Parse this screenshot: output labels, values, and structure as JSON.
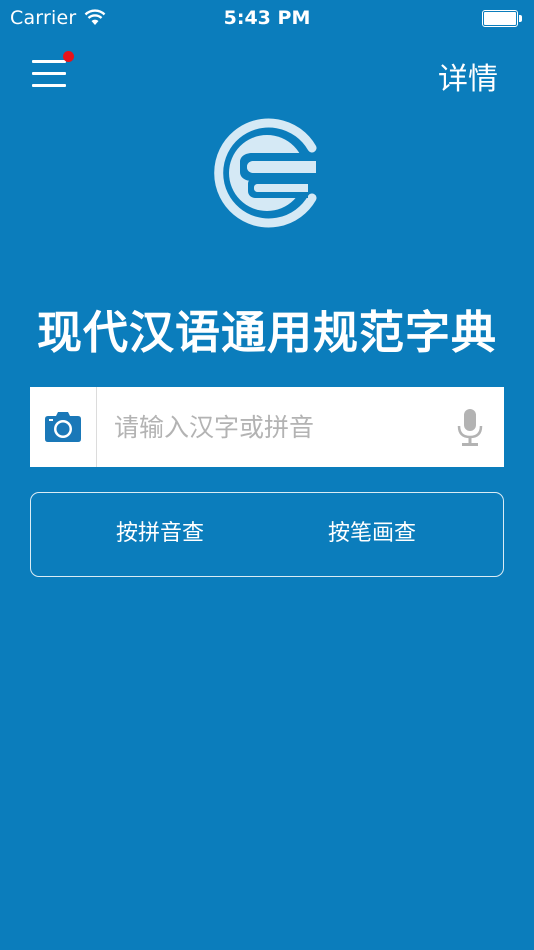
{
  "status_bar": {
    "carrier": "Carrier",
    "time": "5:43 PM",
    "wifi_icon": "wifi-icon",
    "battery_icon": "battery-icon"
  },
  "nav": {
    "menu_icon": "hamburger-menu-icon",
    "notification_dot_color": "#e8121a",
    "details_label": "详情"
  },
  "logo": {
    "icon": "book-logo-icon"
  },
  "title": "现代汉语通用规范字典",
  "search": {
    "placeholder": "请输入汉字或拼音",
    "value": "",
    "camera_icon": "camera-icon",
    "mic_icon": "microphone-icon"
  },
  "lookup": {
    "by_pinyin_label": "按拼音查",
    "by_strokes_label": "按笔画查"
  },
  "colors": {
    "background": "#0b7dbc",
    "logo_light": "#cfe6f3",
    "camera": "#1a78b8",
    "mic": "#b3b3b3"
  }
}
